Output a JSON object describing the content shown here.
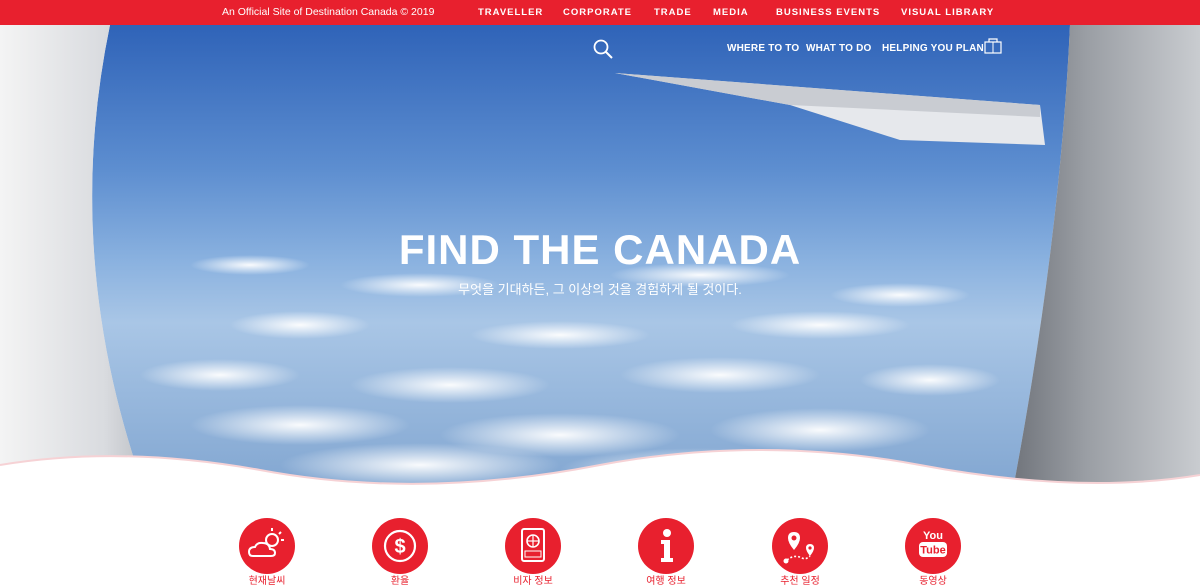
{
  "topbar": {
    "copyright": "An Official Site of Destination Canada © 2019",
    "links": [
      "TRAVELLER",
      "CORPORATE",
      "TRADE",
      "MEDIA",
      "BUSINESS EVENTS",
      "VISUAL LIBRARY"
    ]
  },
  "mainnav": {
    "items": [
      "WHERE TO TO",
      "WHAT TO DO",
      "HELPING YOU PLAN"
    ]
  },
  "hero": {
    "title": "FIND THE CANADA",
    "subtitle": "무엇을 기대하든, 그 이상의 것을 경험하게 될 것이다."
  },
  "services": [
    {
      "label": "현재날씨",
      "icon": "weather-icon"
    },
    {
      "label": "환율",
      "icon": "currency-icon"
    },
    {
      "label": "비자 정보",
      "icon": "passport-icon"
    },
    {
      "label": "여행 정보",
      "icon": "info-icon"
    },
    {
      "label": "추천 일정",
      "icon": "route-icon"
    },
    {
      "label": "동영상",
      "icon": "youtube-icon"
    }
  ],
  "colors": {
    "brand_red": "#e8202e",
    "sky": "#5d8ed0"
  }
}
